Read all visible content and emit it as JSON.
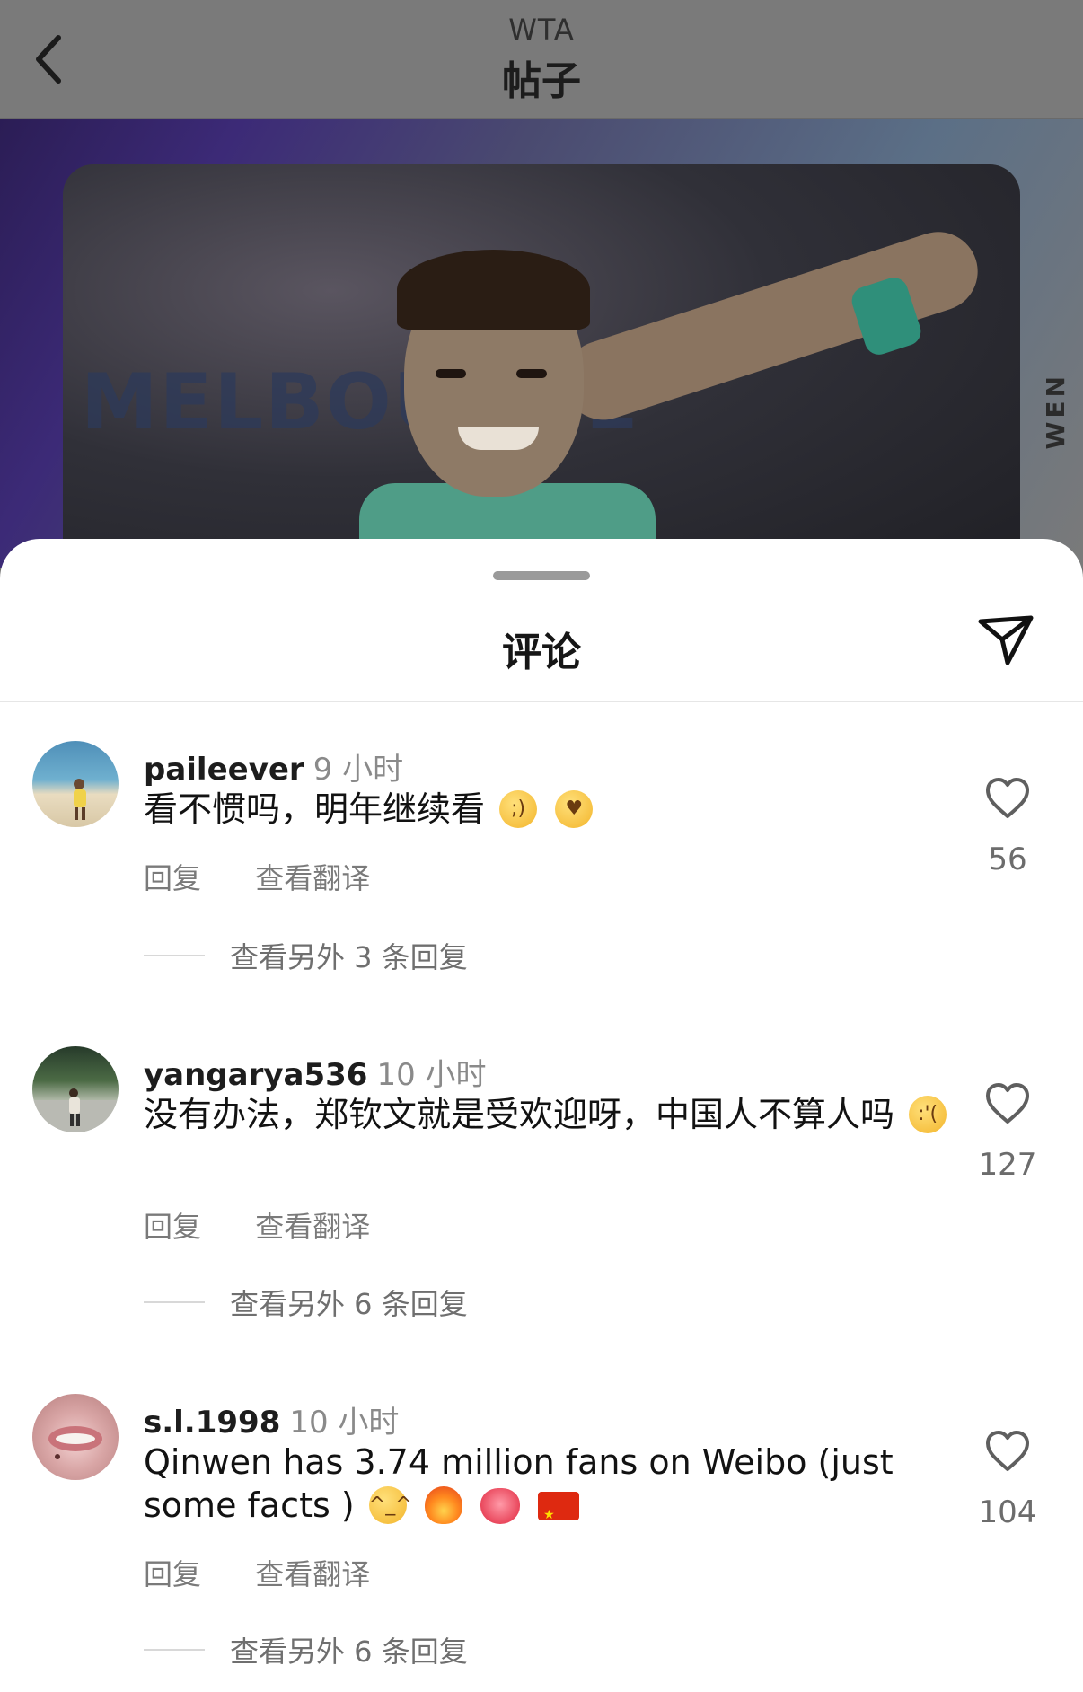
{
  "header": {
    "subtitle": "WTA",
    "title": "帖子"
  },
  "post_image": {
    "banner_text": "MELBOURNE",
    "side_text": "WEN"
  },
  "sheet": {
    "title": "评论"
  },
  "comments": [
    {
      "username": "paileever",
      "time": "9 小时",
      "text": "看不惯吗，明年继续看",
      "emojis": [
        "winking-face",
        "face-blowing-kiss"
      ],
      "reply_label": "回复",
      "translate_label": "查看翻译",
      "more_replies": "查看另外 3 条回复",
      "likes": "56"
    },
    {
      "username": "yangarya536",
      "time": "10 小时",
      "text": "没有办法，郑钦文就是受欢迎呀，中国人不算人吗",
      "emojis": [
        "crying-face"
      ],
      "reply_label": "回复",
      "translate_label": "查看翻译",
      "more_replies": "查看另外 6 条回复",
      "likes": "127"
    },
    {
      "username": "s.l.1998",
      "time": "10 小时",
      "text": "Qinwen has 3.74 million fans on Weibo (just some facts )",
      "emojis": [
        "relieved-face",
        "fire",
        "heart-on-fire",
        "china-flag"
      ],
      "reply_label": "回复",
      "translate_label": "查看翻译",
      "more_replies": "查看另外 6 条回复",
      "likes": "104"
    }
  ],
  "colors": {
    "accent": "#111111",
    "muted": "#7a7a7a",
    "overlay": "#7a7a7a",
    "sheet_bg": "#ffffff"
  },
  "icons": {
    "back": "chevron-left-icon",
    "share": "send-icon",
    "like": "heart-outline-icon"
  }
}
